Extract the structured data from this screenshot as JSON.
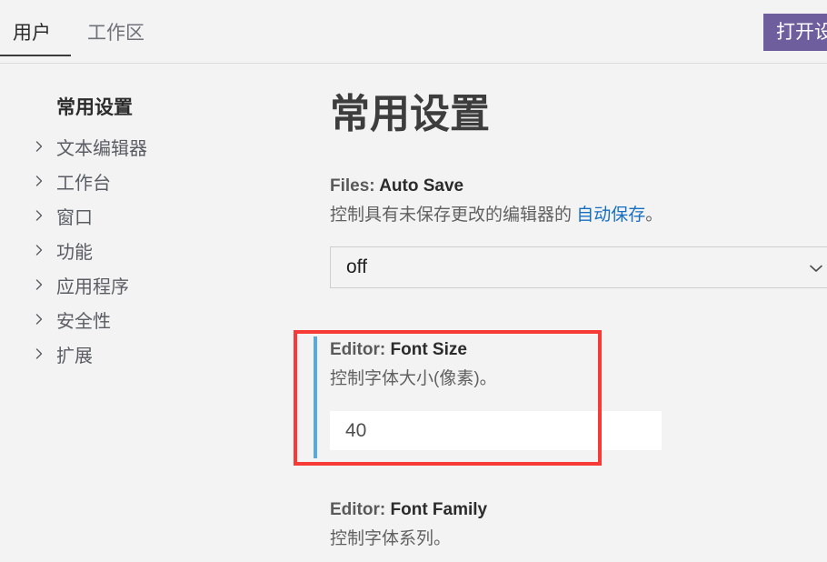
{
  "header": {
    "tabs": [
      {
        "label": "用户",
        "active": true
      },
      {
        "label": "工作区",
        "active": false
      }
    ],
    "open_settings_button": "打开设",
    "accent_purple": "#6f5e9e"
  },
  "sidebar": {
    "section_header": "常用设置",
    "items": [
      {
        "label": "文本编辑器",
        "icon": "chevron-right-icon"
      },
      {
        "label": "工作台",
        "icon": "chevron-right-icon"
      },
      {
        "label": "窗口",
        "icon": "chevron-right-icon"
      },
      {
        "label": "功能",
        "icon": "chevron-right-icon"
      },
      {
        "label": "应用程序",
        "icon": "chevron-right-icon"
      },
      {
        "label": "安全性",
        "icon": "chevron-right-icon"
      },
      {
        "label": "扩展",
        "icon": "chevron-right-icon"
      }
    ]
  },
  "main": {
    "page_title": "常用设置",
    "auto_save": {
      "title_prefix": "Files: ",
      "title_suffix": "Auto Save",
      "desc_before": "控制具有未保存更改的编辑器的 ",
      "desc_link": "自动保存",
      "desc_after": "。",
      "select_value": "off",
      "select_icon": "chevron-down-icon"
    },
    "font_size": {
      "title_prefix": "Editor: ",
      "title_suffix": "Font Size",
      "desc": "控制字体大小(像素)。",
      "input_value": "40",
      "highlight_color": "#f73a35",
      "accent_color": "#5aa8e0"
    },
    "font_family": {
      "title_prefix": "Editor: ",
      "title_suffix": "Font Family",
      "desc": "控制字体系列。"
    }
  }
}
